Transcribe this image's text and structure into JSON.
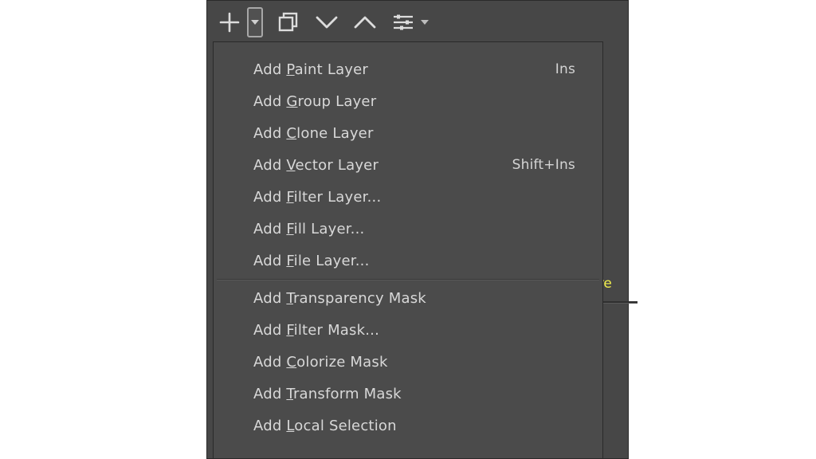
{
  "toolbar": {
    "icons": {
      "add": "plus-icon",
      "dropdown": "chevron-down-icon",
      "duplicate": "duplicate-layer-icon",
      "move_down": "chevron-down-large-icon",
      "move_up": "chevron-up-large-icon",
      "properties": "sliders-icon",
      "properties_chevron": "chevron-down-small-icon"
    }
  },
  "background": {
    "hint_fragment": "ure"
  },
  "menu": {
    "groups": [
      {
        "items": [
          {
            "pre": "Add ",
            "mn": "P",
            "post": "aint Layer",
            "shortcut": "Ins"
          },
          {
            "pre": "Add ",
            "mn": "G",
            "post": "roup Layer",
            "shortcut": ""
          },
          {
            "pre": "Add ",
            "mn": "C",
            "post": "lone Layer",
            "shortcut": ""
          },
          {
            "pre": "Add ",
            "mn": "V",
            "post": "ector Layer",
            "shortcut": "Shift+Ins"
          },
          {
            "pre": "Add ",
            "mn": "F",
            "post": "ilter Layer...",
            "shortcut": ""
          },
          {
            "pre": "Add ",
            "mn": "F",
            "post": "ill Layer...",
            "shortcut": ""
          },
          {
            "pre": "Add ",
            "mn": "F",
            "post": "ile Layer...",
            "shortcut": ""
          }
        ]
      },
      {
        "items": [
          {
            "pre": "Add ",
            "mn": "T",
            "post": "ransparency Mask",
            "shortcut": ""
          },
          {
            "pre": "Add ",
            "mn": "F",
            "post": "ilter Mask...",
            "shortcut": ""
          },
          {
            "pre": "Add ",
            "mn": "C",
            "post": "olorize Mask",
            "shortcut": ""
          },
          {
            "pre": "Add ",
            "mn": "T",
            "post": "ransform Mask",
            "shortcut": ""
          },
          {
            "pre": "Add ",
            "mn": "L",
            "post": "ocal Selection",
            "shortcut": ""
          }
        ]
      }
    ]
  }
}
